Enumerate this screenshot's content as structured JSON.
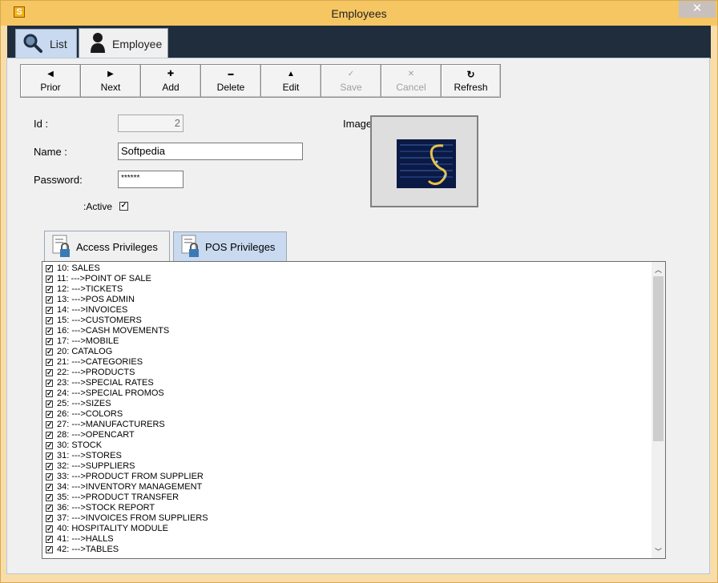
{
  "window": {
    "title": "Employees",
    "close_glyph": "✕",
    "app_icon_letter": "S"
  },
  "main_tabs": [
    {
      "label": "List",
      "icon": "search-icon"
    },
    {
      "label": "Employee",
      "icon": "user-icon"
    }
  ],
  "toolbar": [
    {
      "label": "Prior",
      "icon": "◀",
      "enabled": true
    },
    {
      "label": "Next",
      "icon": "▶",
      "enabled": true
    },
    {
      "label": "Add",
      "icon": "✚",
      "enabled": true
    },
    {
      "label": "Delete",
      "icon": "▬",
      "enabled": true
    },
    {
      "label": "Edit",
      "icon": "▲",
      "enabled": true
    },
    {
      "label": "Save",
      "icon": "✓",
      "enabled": false
    },
    {
      "label": "Cancel",
      "icon": "✕",
      "enabled": false
    },
    {
      "label": "Refresh",
      "icon": "↻",
      "enabled": true
    }
  ],
  "form": {
    "id_label": "Id :",
    "id_value": "2",
    "name_label": "Name :",
    "name_value": "Softpedia",
    "password_label": "Password:",
    "password_value": "******",
    "active_label": ":Active",
    "active_checked": true,
    "image_label": "Image"
  },
  "sub_tabs": [
    {
      "label": "Access Privileges"
    },
    {
      "label": "POS Privileges"
    }
  ],
  "privileges": [
    "10: SALES",
    "11: --->POINT OF SALE",
    "12: --->TICKETS",
    "13: --->POS ADMIN",
    "14: --->INVOICES",
    "15: --->CUSTOMERS",
    "16: --->CASH MOVEMENTS",
    "17: --->MOBILE",
    "20: CATALOG",
    "21: --->CATEGORIES",
    "22: --->PRODUCTS",
    "23: --->SPECIAL RATES",
    "24: --->SPECIAL PROMOS",
    "25: --->SIZES",
    "26: --->COLORS",
    "27: --->MANUFACTURERS",
    "28: --->OPENCART",
    "30: STOCK",
    "31: --->STORES",
    "32: --->SUPPLIERS",
    "33: --->PRODUCT FROM SUPPLIER",
    "34: --->INVENTORY MANAGEMENT",
    "35: --->PRODUCT TRANSFER",
    "36: --->STOCK REPORT",
    "37: --->INVOICES FROM SUPPLIERS",
    "40: HOSPITALITY MODULE",
    "41: --->HALLS",
    "42: --->TABLES"
  ],
  "colors": {
    "titlebar": "#f6c663",
    "dark_band": "#1f2d3d",
    "tab_active": "#f0f0f0",
    "tab_inactive": "#c9daf0"
  }
}
